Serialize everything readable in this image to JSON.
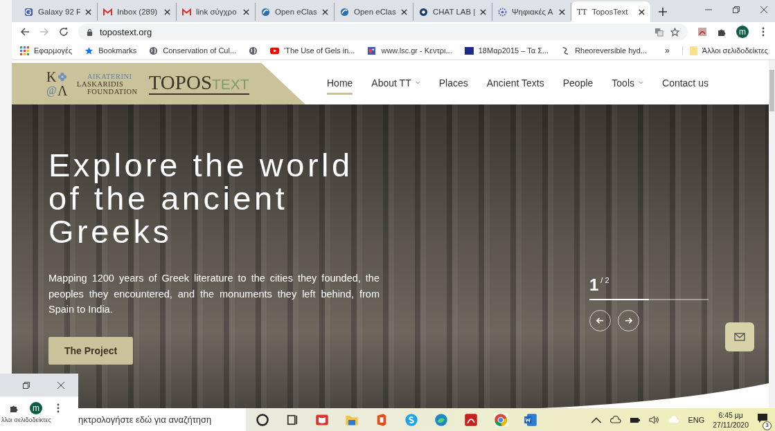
{
  "browser": {
    "tabs": [
      {
        "kind": "g",
        "title": "Galaxy 92 F",
        "selected": false
      },
      {
        "kind": "mail",
        "title": "Inbox (289)",
        "selected": false
      },
      {
        "kind": "mail",
        "title": "link σύγχρο",
        "selected": false
      },
      {
        "kind": "eclass",
        "title": "Open eClas",
        "selected": false
      },
      {
        "kind": "eclass",
        "title": "Open eClas",
        "selected": false
      },
      {
        "kind": "chat",
        "title": "CHAT LAB |",
        "selected": false
      },
      {
        "kind": "flower",
        "title": "Ψηφιακές Α",
        "selected": false
      },
      {
        "kind": "tt",
        "icon_text": "TT",
        "title": "ToposText",
        "selected": true
      }
    ],
    "address": "topostext.org",
    "bookmarks": [
      {
        "kind": "apps",
        "label": "Εφαρμογές"
      },
      {
        "kind": "star",
        "label": "Bookmarks"
      },
      {
        "kind": "globe",
        "label": "Conservation of Cul..."
      },
      {
        "kind": "globe"
      },
      {
        "kind": "youtube",
        "label": "'The Use of Gels in..."
      },
      {
        "kind": "news",
        "label": "www.lsc.gr - Κεντρι..."
      },
      {
        "kind": "ert",
        "label": "18Μαρ2015 – Τα Σ..."
      },
      {
        "kind": "spiral",
        "label": "Rheoreversible hyd..."
      }
    ],
    "bookmarks_more": "»",
    "other_bookmarks": "Άλλοι σελιδοδείκτες",
    "profile_initial": "m"
  },
  "site": {
    "logo": {
      "monogram_top": "Κ",
      "monogram_bottom_left": "@",
      "monogram_bottom_right": "Λ",
      "foundation": [
        "AIKATERINI",
        "LASKARIDIS",
        "FOUNDATION"
      ],
      "brand": "TOPOS",
      "brand_suffix": "TEXT"
    },
    "nav": [
      {
        "label": "Home",
        "selected": true,
        "dropdown": false
      },
      {
        "label": "About TT",
        "selected": false,
        "dropdown": true
      },
      {
        "label": "Places",
        "selected": false,
        "dropdown": false
      },
      {
        "label": "Ancient Texts",
        "selected": false,
        "dropdown": false
      },
      {
        "label": "People",
        "selected": false,
        "dropdown": false
      },
      {
        "label": "Tools",
        "selected": false,
        "dropdown": true
      },
      {
        "label": "Contact us",
        "selected": false,
        "dropdown": false
      }
    ],
    "hero": {
      "title": "Explore the world of the ancient Greeks",
      "text": "Mapping 1200 years of Greek literature to the cities they founded, the peoples they encountered, and the monuments they left behind, from Spain to India.",
      "button": "The Project"
    },
    "slider": {
      "current": "1",
      "total": "/ 2",
      "level": 0.5
    }
  },
  "taskbar": {
    "search_placeholder": "ηκτρολογήστε εδώ για αναζήτηση",
    "language": "ENG",
    "time": "6:45 μμ",
    "date": "27/11/2020",
    "notifications": "3"
  },
  "background_window": {
    "profile_initial": "m",
    "bookmarks_label": "λλοι σελιδοδείκτες"
  }
}
